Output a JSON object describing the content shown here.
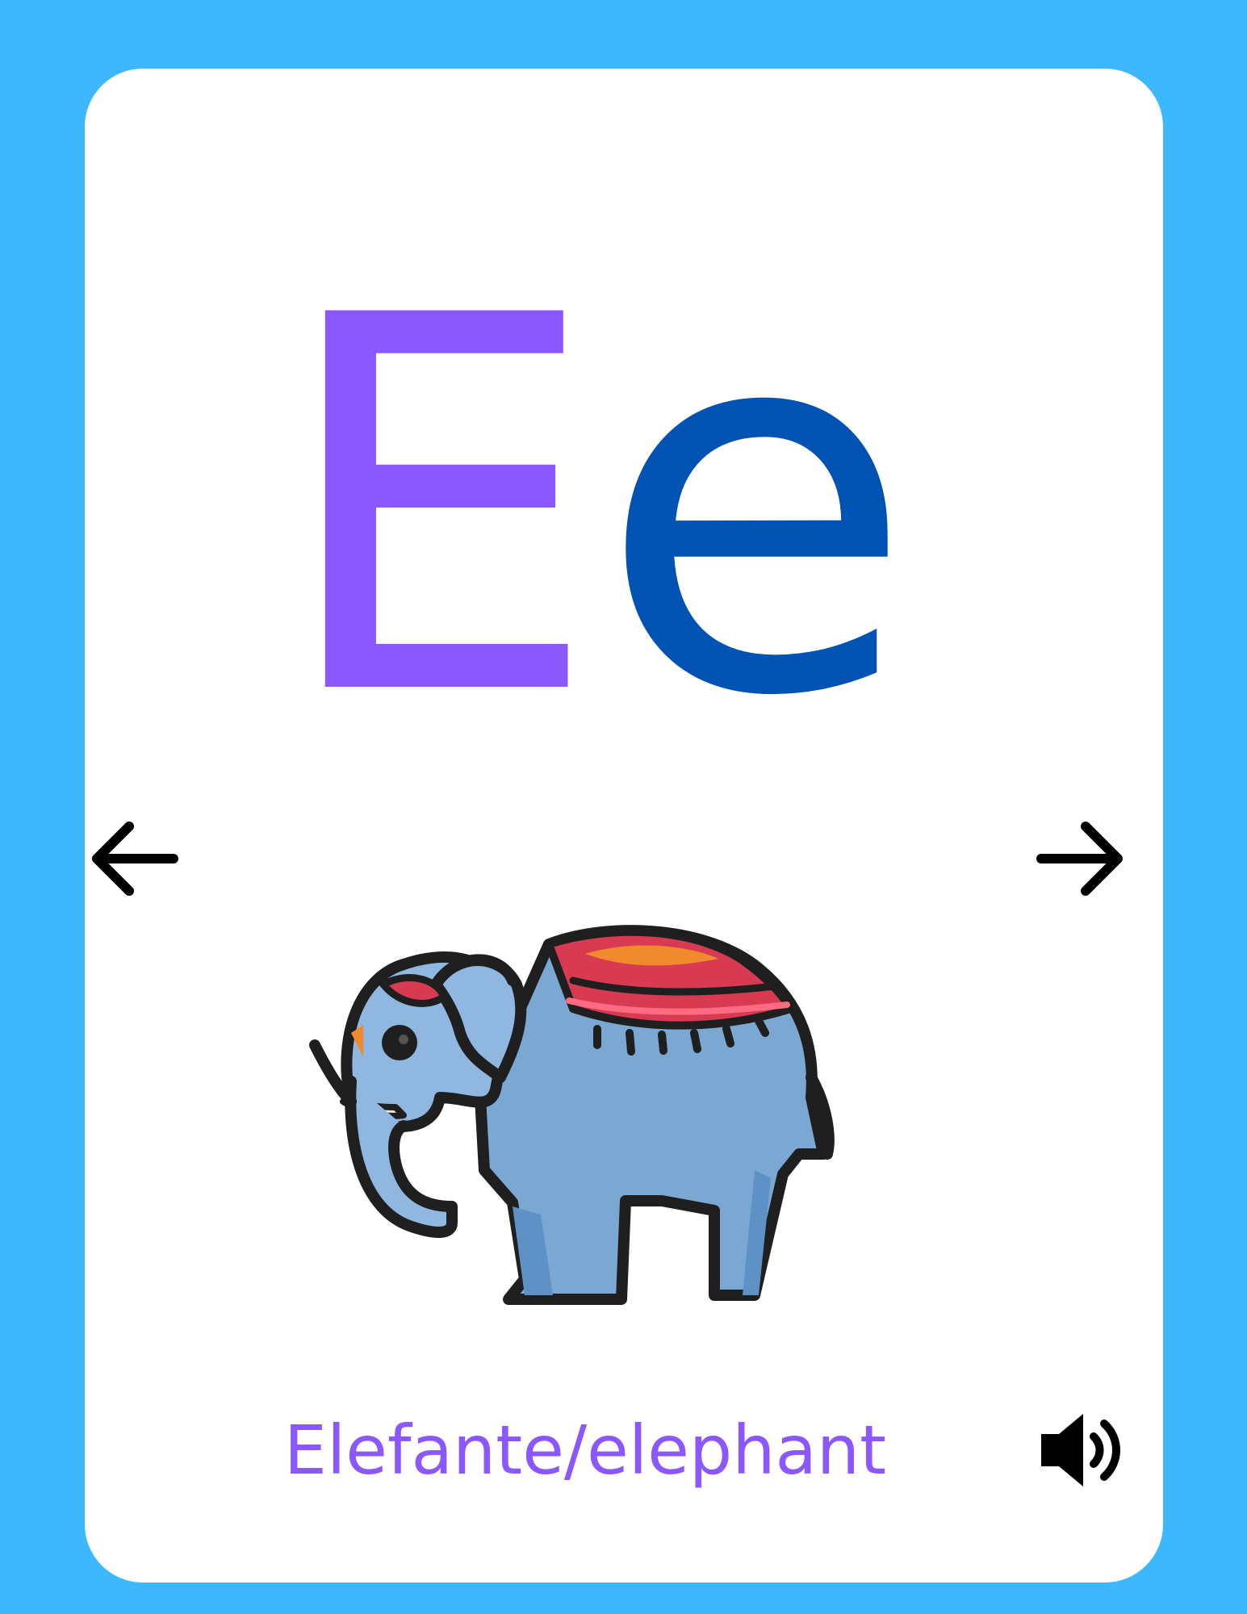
{
  "card": {
    "uppercase_letter": "E",
    "lowercase_letter": "e",
    "word": "Elefante/elephant"
  },
  "icons": {
    "previous": "arrow-left-icon",
    "next": "arrow-right-icon",
    "audio": "speaker-volume-icon",
    "picture": "elephant-icon"
  },
  "colors": {
    "background": "#3DB8FF",
    "card": "#FFFFFF",
    "uppercase_letter": "#8B57FF",
    "lowercase_letter": "#0052B3",
    "word": "#8B57FF"
  }
}
